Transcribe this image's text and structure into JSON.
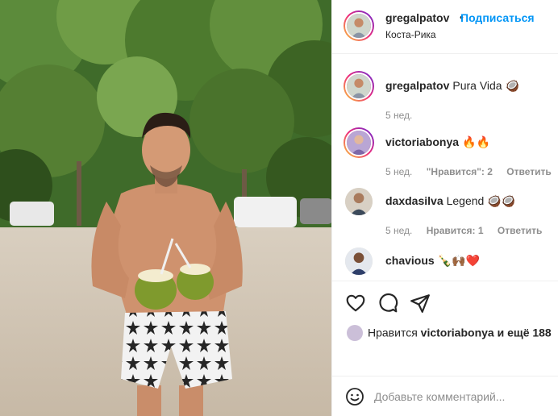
{
  "header": {
    "username": "gregalpatov",
    "separator": "•",
    "follow_label": "Подписаться",
    "location": "Коста-Рика"
  },
  "comments": [
    {
      "username": "gregalpatov",
      "text": "Pura Vida 🥥",
      "time": "5 нед.",
      "likes": "",
      "reply": ""
    },
    {
      "username": "victoriabonya",
      "text": "🔥🔥",
      "time": "5 нед.",
      "likes": "\"Нравится\": 2",
      "reply": "Ответить"
    },
    {
      "username": "daxdasilva",
      "text": "Legend 🥥🥥",
      "time": "5 нед.",
      "likes": "Нравится: 1",
      "reply": "Ответить"
    },
    {
      "username": "chavious",
      "text": "🍾🙌🏾❤️",
      "time": "",
      "likes": "",
      "reply": ""
    }
  ],
  "actions": {
    "icons": [
      "heart-icon",
      "comment-icon",
      "share-icon"
    ],
    "likes_prefix": "Нравится",
    "likes_user": "victoriabonya",
    "likes_suffix": "и ещё 188"
  },
  "add_comment": {
    "placeholder": "Добавьте комментарий..."
  },
  "colors": {
    "accent": "#0095f6",
    "text": "#262626",
    "muted": "#8e8e8e",
    "border": "#efefef"
  }
}
